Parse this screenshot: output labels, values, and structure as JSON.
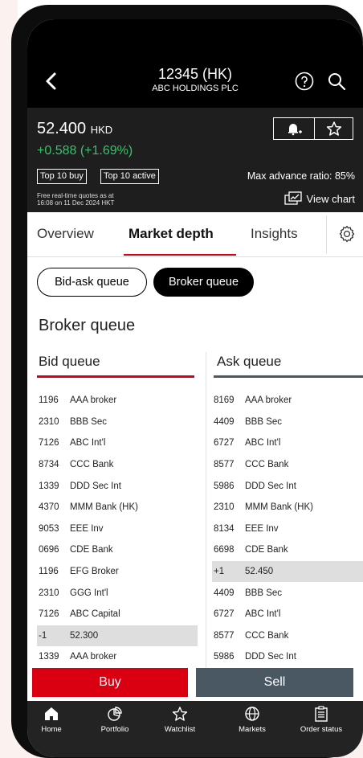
{
  "header": {
    "title": "12345 (HK)",
    "subtitle": "ABC HOLDINGS PLC"
  },
  "quote": {
    "price": "52.400",
    "currency": "HKD",
    "change": "+0.588 (+1.69%)",
    "tag_top_buy": "Top 10 buy",
    "tag_top_active": "Top 10 active",
    "max_advance_ratio": "Max advance ratio: 85%",
    "disclaimer_line1": "Free real-time quotes as at",
    "disclaimer_line2": "16:08 on 11 Dec 2024 HKT",
    "view_chart": "View chart",
    "change_color": "#39c26b"
  },
  "tabs": {
    "overview": "Overview",
    "market_depth": "Market depth",
    "insights": "Insights",
    "active": "Market depth"
  },
  "toggle": {
    "bid_ask": "Bid-ask queue",
    "broker": "Broker queue",
    "selected": "Broker queue"
  },
  "section_title": "Broker queue",
  "bid": {
    "header": "Bid queue",
    "rows": [
      {
        "code": "1196",
        "name": "AAA broker"
      },
      {
        "code": "2310",
        "name": "BBB Sec"
      },
      {
        "code": "7126",
        "name": "ABC Int'l"
      },
      {
        "code": "8734",
        "name": "CCC Bank"
      },
      {
        "code": "1339",
        "name": "DDD Sec Int"
      },
      {
        "code": "4370",
        "name": "MMM Bank (HK)"
      },
      {
        "code": "9053",
        "name": "EEE Inv"
      },
      {
        "code": "0696",
        "name": "CDE Bank"
      },
      {
        "code": "1196",
        "name": "EFG Broker"
      },
      {
        "code": "2310",
        "name": "GGG Int'l"
      },
      {
        "code": "7126",
        "name": "ABC Capital"
      },
      {
        "code": "-1",
        "name": "52.300"
      },
      {
        "code": "1339",
        "name": "AAA broker"
      }
    ]
  },
  "ask": {
    "header": "Ask queue",
    "rows": [
      {
        "code": "8169",
        "name": "AAA broker"
      },
      {
        "code": "4409",
        "name": "BBB Sec"
      },
      {
        "code": "6727",
        "name": "ABC Int'l"
      },
      {
        "code": "8577",
        "name": "CCC Bank"
      },
      {
        "code": "5986",
        "name": "DDD Sec Int"
      },
      {
        "code": "2310",
        "name": "MMM Bank (HK)"
      },
      {
        "code": "8134",
        "name": "EEE Inv"
      },
      {
        "code": "6698",
        "name": "CDE Bank"
      },
      {
        "code": "+1",
        "name": "52.450"
      },
      {
        "code": "4409",
        "name": "BBB Sec"
      },
      {
        "code": "6727",
        "name": "ABC Int'l"
      },
      {
        "code": "8577",
        "name": "CCC Bank"
      },
      {
        "code": "5986",
        "name": "DDD Sec Int"
      }
    ]
  },
  "trade": {
    "buy": "Buy",
    "sell": "Sell",
    "buy_color": "#db0011",
    "sell_color": "#4a5864"
  },
  "nav": {
    "home": "Home",
    "portfolio": "Portfolio",
    "watchlist": "Watchlist",
    "markets": "Markets",
    "orders": "Order status"
  },
  "icons": [
    "back-icon",
    "help-icon",
    "search-icon",
    "bell-plus-icon",
    "star-icon",
    "chart-icon",
    "gear-icon",
    "home-icon",
    "portfolio-icon",
    "watchlist-icon",
    "markets-icon",
    "order-status-icon"
  ]
}
